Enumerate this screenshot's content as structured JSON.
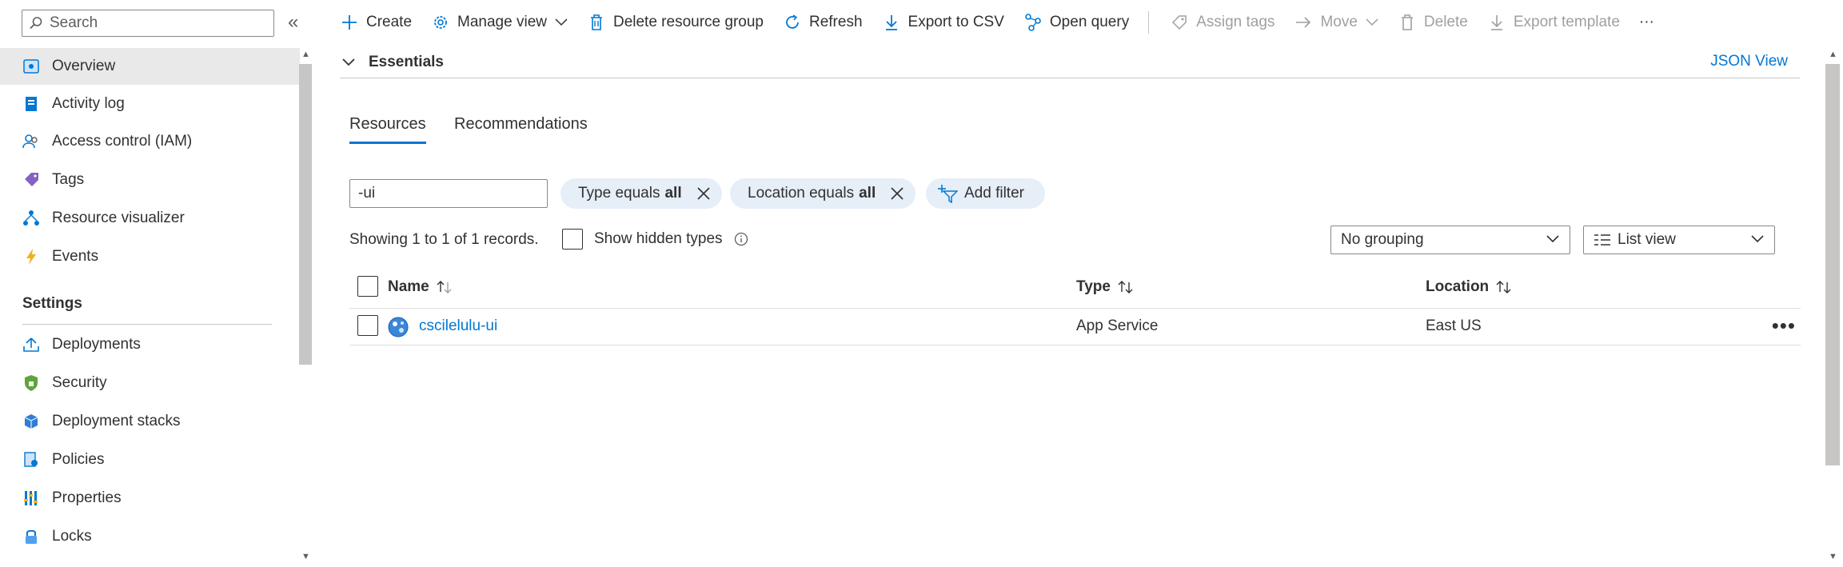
{
  "sidebar": {
    "search_placeholder": "Search",
    "collapse_glyph": "«",
    "items": [
      {
        "label": "Overview",
        "icon": "overview-icon"
      },
      {
        "label": "Activity log",
        "icon": "activity-log-icon"
      },
      {
        "label": "Access control (IAM)",
        "icon": "people-icon"
      },
      {
        "label": "Tags",
        "icon": "tag-icon"
      },
      {
        "label": "Resource visualizer",
        "icon": "visualizer-icon"
      },
      {
        "label": "Events",
        "icon": "lightning-icon"
      }
    ],
    "settings_header": "Settings",
    "settings_items": [
      {
        "label": "Deployments",
        "icon": "upload-icon"
      },
      {
        "label": "Security",
        "icon": "shield-icon"
      },
      {
        "label": "Deployment stacks",
        "icon": "cube-icon"
      },
      {
        "label": "Policies",
        "icon": "policy-icon"
      },
      {
        "label": "Properties",
        "icon": "properties-icon"
      },
      {
        "label": "Locks",
        "icon": "lock-icon"
      }
    ]
  },
  "toolbar": {
    "create": "Create",
    "manage_view": "Manage view",
    "delete_group": "Delete resource group",
    "refresh": "Refresh",
    "export_csv": "Export to CSV",
    "open_query": "Open query",
    "assign_tags": "Assign tags",
    "move": "Move",
    "delete": "Delete",
    "export_template": "Export template",
    "more": "···"
  },
  "essentials": {
    "title": "Essentials",
    "json_view": "JSON View"
  },
  "tabs": {
    "resources": "Resources",
    "recommendations": "Recommendations"
  },
  "filters": {
    "search_value": "-ui",
    "type_label": "Type equals",
    "type_value": "all",
    "location_label": "Location equals",
    "location_value": "all",
    "add_filter": "Add filter"
  },
  "records": {
    "text": "Showing 1 to 1 of 1 records.",
    "show_hidden": "Show hidden types",
    "grouping": "No grouping",
    "view": "List view"
  },
  "table": {
    "headers": {
      "name": "Name",
      "type": "Type",
      "location": "Location"
    },
    "rows": [
      {
        "name": "cscilelulu-ui",
        "type": "App Service",
        "location": "East US"
      }
    ]
  },
  "colors": {
    "accent": "#0078d4",
    "pill_bg": "#e6eef8",
    "selected_bg": "#e9e9e9"
  }
}
